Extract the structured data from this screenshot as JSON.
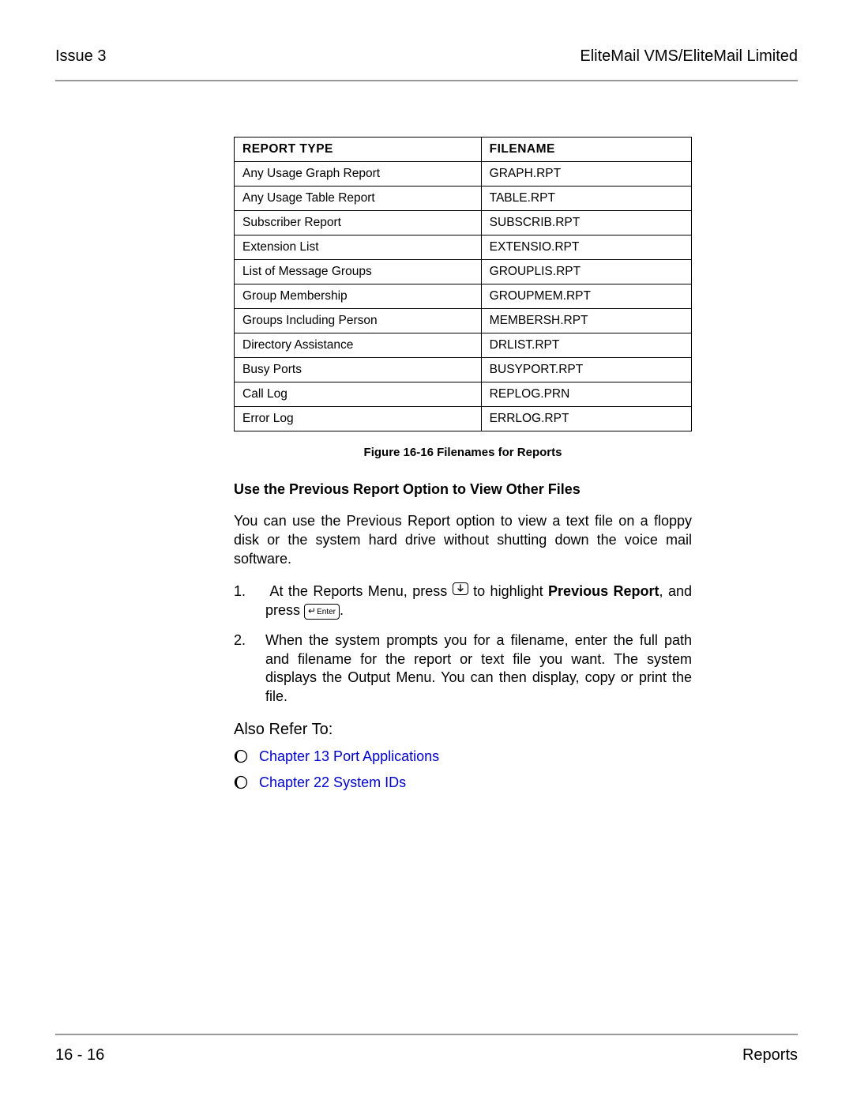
{
  "header": {
    "left": "Issue 3",
    "right": "EliteMail VMS/EliteMail Limited"
  },
  "table": {
    "headers": {
      "type": "Report Type",
      "file": "Filename"
    },
    "rows": [
      {
        "type": "Any Usage Graph Report",
        "file": "GRAPH.RPT"
      },
      {
        "type": "Any Usage Table Report",
        "file": "TABLE.RPT"
      },
      {
        "type": "Subscriber Report",
        "file": "SUBSCRIB.RPT"
      },
      {
        "type": "Extension List",
        "file": "EXTENSIO.RPT"
      },
      {
        "type": "List of Message Groups",
        "file": "GROUPLIS.RPT"
      },
      {
        "type": "Group Membership",
        "file": "GROUPMEM.RPT"
      },
      {
        "type": "Groups Including Person",
        "file": "MEMBERSH.RPT"
      },
      {
        "type": "Directory Assistance",
        "file": "DRLIST.RPT"
      },
      {
        "type": "Busy Ports",
        "file": "BUSYPORT.RPT"
      },
      {
        "type": "Call Log",
        "file": "REPLOG.PRN"
      },
      {
        "type": "Error Log",
        "file": "ERRLOG.RPT"
      }
    ]
  },
  "figure_caption": "Figure 16-16   Filenames for Reports",
  "section_heading": "Use the Previous Report Option to View Other Files",
  "intro_para": "You can use the Previous Report option to view a text file on a floppy disk or the system hard drive without shutting down the voice mail software.",
  "steps": {
    "s1": {
      "pre_key1": "At the Reports Menu, press ",
      "mid": " to highlight  ",
      "bold": "Previous Report",
      "post": ", and press ",
      "end": "."
    },
    "s2": "When the system prompts you for a filename, enter the full path and filename for the report or text file you want. The system displays the Output Menu. You can then display, copy or print the file."
  },
  "also_refer_label": "Also Refer To:",
  "refs": [
    {
      "label": "Chapter 13 Port Applications"
    },
    {
      "label": "Chapter 22 System IDs"
    }
  ],
  "key_enter_label": "Enter",
  "footer": {
    "left": "16 - 16",
    "right": "Reports"
  }
}
